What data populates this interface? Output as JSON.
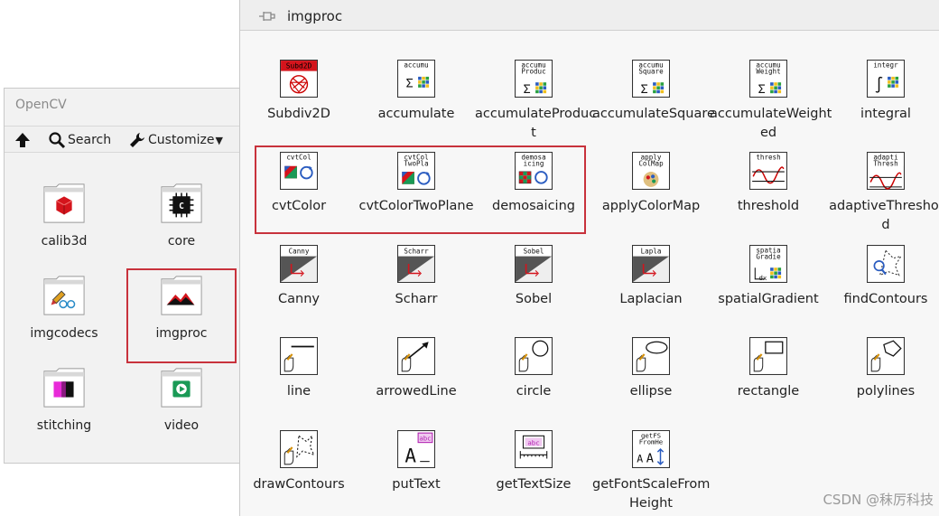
{
  "opencv_palette": {
    "title": "OpenCV",
    "toolbar": {
      "search_label": "Search",
      "customize_label": "Customize"
    },
    "folders": [
      {
        "label": "calib3d",
        "icon": "red-cube-icon"
      },
      {
        "label": "core",
        "icon": "chip-icon"
      },
      {
        "label": "imgcodecs",
        "icon": "pencil-glasses-icon"
      },
      {
        "label": "imgproc",
        "icon": "mountain-icon"
      },
      {
        "label": "stitching",
        "icon": "stitching-icon"
      },
      {
        "label": "video",
        "icon": "video-play-icon"
      }
    ]
  },
  "imgproc_palette": {
    "title": "imgproc",
    "items": [
      {
        "label": "Subdiv2D",
        "icon_text": [
          "Subd2D"
        ]
      },
      {
        "label": "accumulate",
        "icon_text": [
          "accumu"
        ]
      },
      {
        "label": "accumulateProduct",
        "icon_text": [
          "accumu",
          "Produc"
        ]
      },
      {
        "label": "accumulateSquare",
        "icon_text": [
          "accumu",
          "Square"
        ]
      },
      {
        "label": "accumulateWeighted",
        "icon_text": [
          "accumu",
          "Weight"
        ]
      },
      {
        "label": "integral",
        "icon_text": [
          "integr"
        ]
      },
      {
        "label": "cvtColor",
        "icon_text": [
          "cvtCol"
        ]
      },
      {
        "label": "cvtColorTwoPlane",
        "icon_text": [
          "cvtCol",
          "TwoPla"
        ]
      },
      {
        "label": "demosaicing",
        "icon_text": [
          "demosa",
          "icing"
        ]
      },
      {
        "label": "applyColorMap",
        "icon_text": [
          "apply",
          "ColMap"
        ]
      },
      {
        "label": "threshold",
        "icon_text": [
          "thresh"
        ]
      },
      {
        "label": "adaptiveThreshold",
        "icon_text": [
          "adapti",
          "Thresh"
        ]
      },
      {
        "label": "Canny",
        "icon_text": [
          "Canny"
        ]
      },
      {
        "label": "Scharr",
        "icon_text": [
          "Scharr"
        ]
      },
      {
        "label": "Sobel",
        "icon_text": [
          "Sobel"
        ]
      },
      {
        "label": "Laplacian",
        "icon_text": [
          "Lapla"
        ]
      },
      {
        "label": "spatialGradient",
        "icon_text": [
          "spatia",
          "Gradie"
        ]
      },
      {
        "label": "findContours",
        "icon_text": []
      },
      {
        "label": "line",
        "icon_text": []
      },
      {
        "label": "arrowedLine",
        "icon_text": []
      },
      {
        "label": "circle",
        "icon_text": []
      },
      {
        "label": "ellipse",
        "icon_text": []
      },
      {
        "label": "rectangle",
        "icon_text": []
      },
      {
        "label": "polylines",
        "icon_text": []
      },
      {
        "label": "drawContours",
        "icon_text": []
      },
      {
        "label": "putText",
        "icon_text": [
          "abc"
        ]
      },
      {
        "label": "getTextSize",
        "icon_text": [
          "abc"
        ]
      },
      {
        "label": "getFontScaleFromHeight",
        "icon_text": [
          "getFS",
          "FromHe"
        ]
      }
    ]
  },
  "watermark": "CSDN @秣厉科技",
  "colors": {
    "highlight": "#c8323c"
  }
}
